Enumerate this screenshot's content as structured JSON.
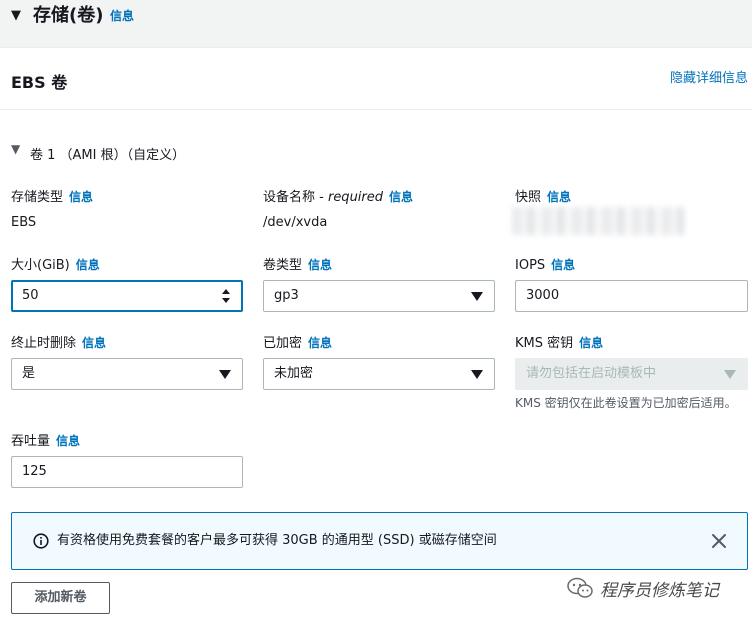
{
  "section": {
    "title": "存储(卷)",
    "info": "信息"
  },
  "panel": {
    "title": "EBS 卷",
    "hide_details": "隐藏详细信息"
  },
  "volume": {
    "title": "卷 1 （AMI 根）（自定义）"
  },
  "fields": {
    "storage_type": {
      "label": "存储类型",
      "info": "信息",
      "value": "EBS"
    },
    "device_name": {
      "label": "设备名称 - ",
      "required": "required",
      "info": "信息",
      "value": "/dev/xvda"
    },
    "snapshot": {
      "label": "快照",
      "info": "信息"
    },
    "size": {
      "label": "大小(GiB)",
      "info": "信息",
      "value": "50"
    },
    "volume_type": {
      "label": "卷类型",
      "info": "信息",
      "value": "gp3"
    },
    "iops": {
      "label": "IOPS",
      "info": "信息",
      "value": "3000"
    },
    "delete_on_termination": {
      "label": "终止时删除",
      "info": "信息",
      "value": "是"
    },
    "encrypted": {
      "label": "已加密",
      "info": "信息",
      "value": "未加密"
    },
    "kms_key": {
      "label": "KMS 密钥",
      "info": "信息",
      "placeholder": "请勿包括在启动模板中",
      "help": "KMS 密钥仅在此卷设置为已加密后适用。"
    },
    "throughput": {
      "label": "吞吐量",
      "info": "信息",
      "value": "125"
    }
  },
  "alert": {
    "text": "有资格使用免费套餐的客户最多可获得 30GB 的通用型 (SSD) 或磁存储空间"
  },
  "add_button": "添加新卷",
  "watermark": "程序员修炼笔记",
  "colors": {
    "link": "#0073bb",
    "focus_border": "#0073bb",
    "alert_bg": "#f1faff",
    "section_bg": "#f2f3f3"
  }
}
